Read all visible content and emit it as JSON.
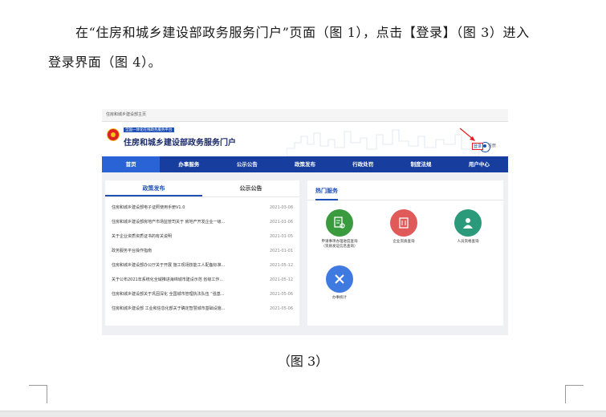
{
  "doc": {
    "line1": "在“住房和城乡建设部政务服务门户”页面（图 1），点击【登录】（图 3）进入",
    "line2": "登录界面（图 4）。",
    "caption": "（图 3）"
  },
  "shot": {
    "top_link": "住房和城乡建设部主页",
    "badge": "全国一体化在线政务服务平台",
    "title": "住房和城乡建设部政务服务门户",
    "login": "登录",
    "register": "注册",
    "nav": [
      "首页",
      "办事服务",
      "公示公告",
      "政策发布",
      "行政处罚",
      "制度法规",
      "用户中心"
    ],
    "tabs": [
      "政策发布",
      "公示公告"
    ],
    "news": [
      {
        "title": "住房和城乡建设部电子证照使用手册V1.0",
        "date": "2021-03-08"
      },
      {
        "title": "住房和城乡建设部房地产市场监管司关于 房地产开发企业一级...",
        "date": "2021-01-06"
      },
      {
        "title": "关于企业资质资质证书的有关说明",
        "date": "2021-01-05"
      },
      {
        "title": "政务服务平台操作指南",
        "date": "2021-01-01"
      },
      {
        "title": "住房和城乡建设部办公厅关于开展 施工现场技能工人配备标准...",
        "date": "2021-05-12"
      },
      {
        "title": "关于公布2021年系统化全域推进海绵城市建设示范 省级工作...",
        "date": "2021-05-12"
      },
      {
        "title": "住房和城乡建设部关于巩固深化 全国城市管理执法队伍 “强基...",
        "date": "2021-05-06"
      },
      {
        "title": "住房和城乡建设部 工业和信息化部关于确定智慧城市基础设施...",
        "date": "2021-05-06"
      }
    ],
    "hot_title": "热门服务",
    "services": [
      {
        "label_a": "申请事项办理进度查询",
        "label_b": "（资质发证信息查询）",
        "color": "#3a9a3e",
        "icon": "document-search-icon"
      },
      {
        "label_a": "企业资质查询",
        "label_b": "",
        "color": "#e05a5a",
        "icon": "building-icon"
      },
      {
        "label_a": "人员资格查询",
        "label_b": "",
        "color": "#2a9a7a",
        "icon": "person-icon"
      },
      {
        "label_a": "办事统计",
        "label_b": "",
        "color": "#3f7ae0",
        "icon": "tools-icon"
      }
    ]
  }
}
